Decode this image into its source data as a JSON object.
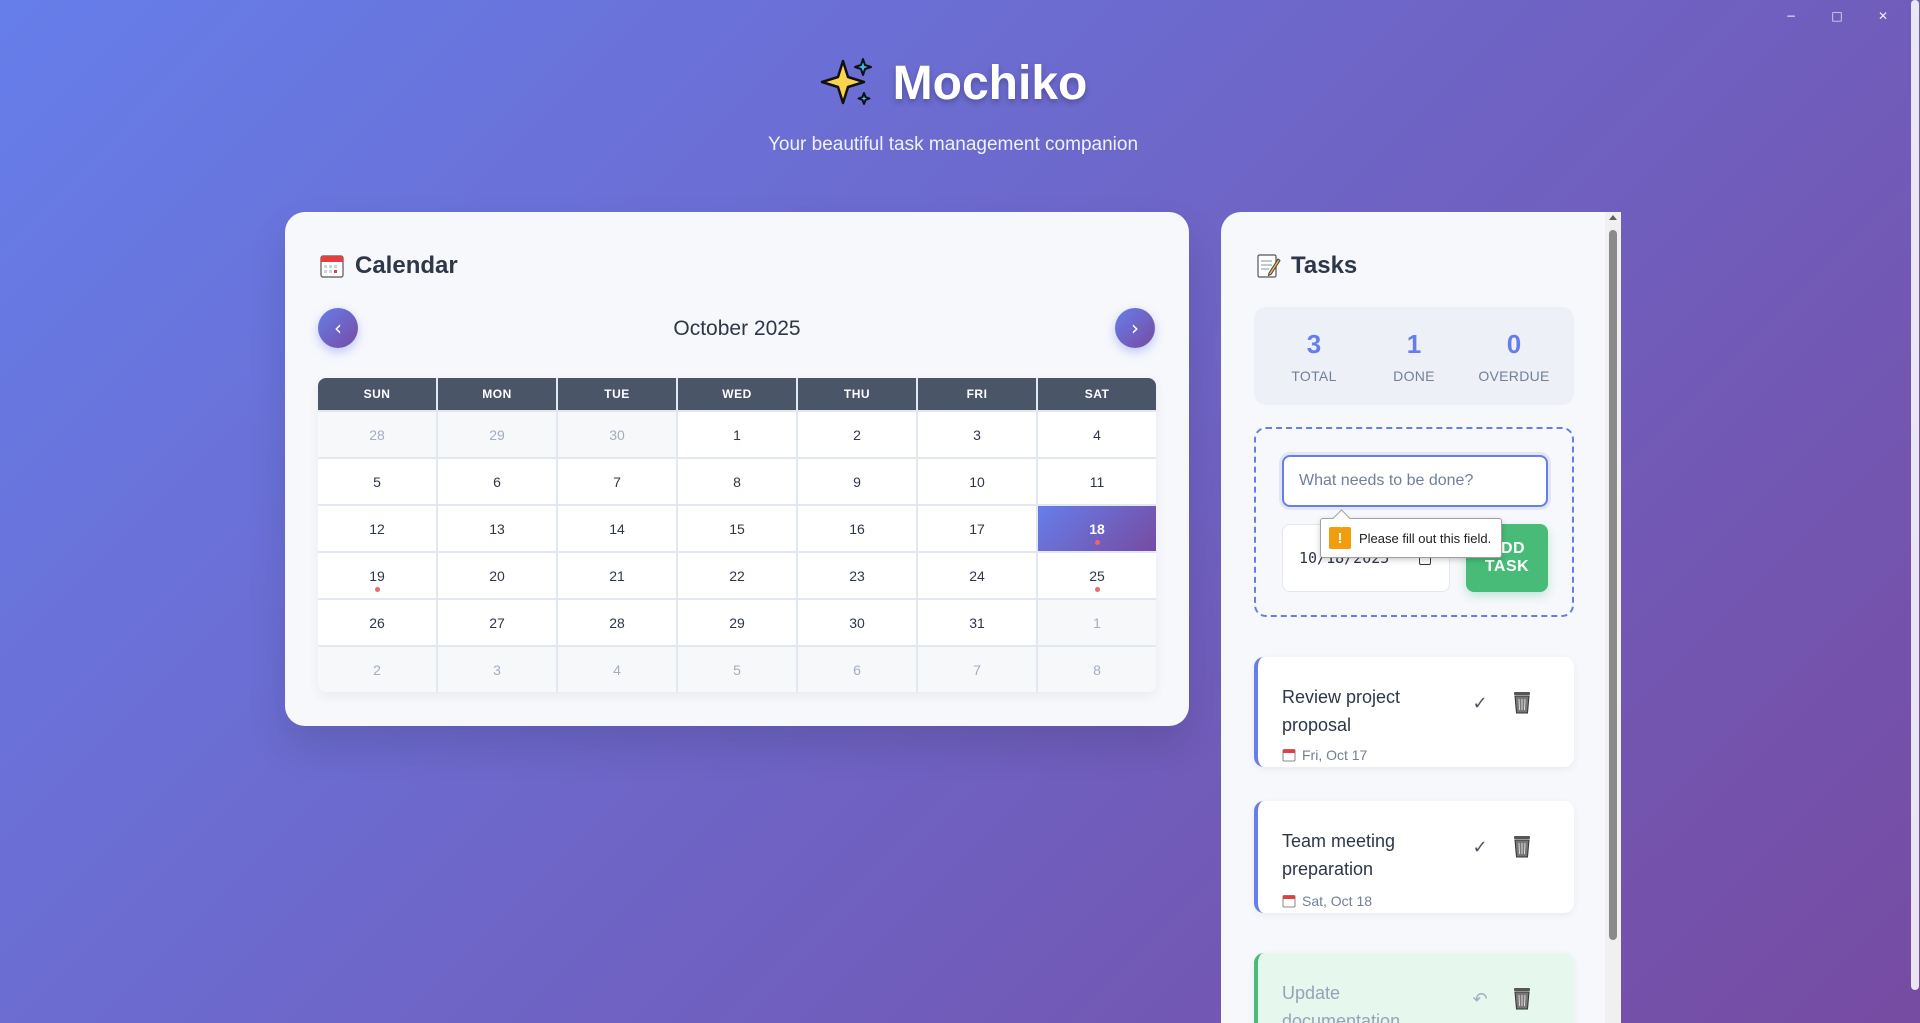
{
  "window": {
    "minimize": "−",
    "maximize": "□",
    "close": "✕"
  },
  "header": {
    "title": "Mochiko",
    "subtitle": "Your beautiful task management companion"
  },
  "calendar": {
    "title": "Calendar",
    "month": "October 2025",
    "prev_label": "‹",
    "next_label": "›",
    "weekdays": [
      "SUN",
      "MON",
      "TUE",
      "WED",
      "THU",
      "FRI",
      "SAT"
    ],
    "days": [
      {
        "d": "28",
        "other": true
      },
      {
        "d": "29",
        "other": true
      },
      {
        "d": "30",
        "other": true
      },
      {
        "d": "1"
      },
      {
        "d": "2"
      },
      {
        "d": "3"
      },
      {
        "d": "4"
      },
      {
        "d": "5"
      },
      {
        "d": "6"
      },
      {
        "d": "7"
      },
      {
        "d": "8"
      },
      {
        "d": "9"
      },
      {
        "d": "10"
      },
      {
        "d": "11"
      },
      {
        "d": "12"
      },
      {
        "d": "13"
      },
      {
        "d": "14"
      },
      {
        "d": "15"
      },
      {
        "d": "16"
      },
      {
        "d": "17"
      },
      {
        "d": "18",
        "today": true,
        "dot": true
      },
      {
        "d": "19",
        "dot": true
      },
      {
        "d": "20"
      },
      {
        "d": "21"
      },
      {
        "d": "22"
      },
      {
        "d": "23"
      },
      {
        "d": "24"
      },
      {
        "d": "25",
        "dot": true
      },
      {
        "d": "26"
      },
      {
        "d": "27"
      },
      {
        "d": "28"
      },
      {
        "d": "29"
      },
      {
        "d": "30"
      },
      {
        "d": "31"
      },
      {
        "d": "1",
        "other": true
      },
      {
        "d": "2",
        "other": true
      },
      {
        "d": "3",
        "other": true
      },
      {
        "d": "4",
        "other": true
      },
      {
        "d": "5",
        "other": true
      },
      {
        "d": "6",
        "other": true
      },
      {
        "d": "7",
        "other": true
      },
      {
        "d": "8",
        "other": true
      }
    ]
  },
  "tasks_panel": {
    "title": "Tasks",
    "stats": [
      {
        "value": "3",
        "label": "TOTAL"
      },
      {
        "value": "1",
        "label": "DONE"
      },
      {
        "value": "0",
        "label": "OVERDUE"
      }
    ],
    "form": {
      "placeholder": "What needs to be done?",
      "date_value": "10/18/2025",
      "add_label": "ADD TASK",
      "validation_message": "Please fill out this field."
    },
    "tasks": [
      {
        "title": "Review project proposal",
        "date": "Fri, Oct 17",
        "done": false,
        "action": "✓"
      },
      {
        "title": "Team meeting preparation",
        "date": "Sat, Oct 18",
        "done": false,
        "action": "✓"
      },
      {
        "title": "Update documentation",
        "date": "",
        "done": true,
        "action": "↶"
      }
    ]
  },
  "colors": {
    "accent": "#667eea",
    "accent2": "#764ba2",
    "success": "#48bb78",
    "dot": "#f56565"
  }
}
